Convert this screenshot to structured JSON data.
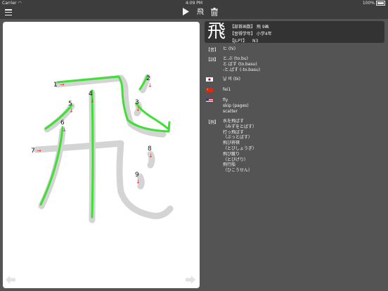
{
  "status": {
    "carrier": "Carrier",
    "time": "4:09 PM",
    "battery": "100%"
  },
  "toolbar": {
    "icons": [
      "menu-icon",
      "play-icon",
      "kanji-toggle-icon",
      "trash-icon"
    ],
    "kanji_label": "飛"
  },
  "canvas": {
    "strokes": [
      {
        "number": "1",
        "arrow": "→"
      },
      {
        "number": "2",
        "arrow": "↓"
      },
      {
        "number": "3",
        "arrow": "↓"
      },
      {
        "number": "4",
        "arrow": "↓"
      },
      {
        "number": "5",
        "arrow": "↓"
      },
      {
        "number": "6",
        "arrow": "↓"
      },
      {
        "number": "7",
        "arrow": "→"
      },
      {
        "number": "8",
        "arrow": "↓"
      },
      {
        "number": "9",
        "arrow": "↓"
      }
    ],
    "nav": {
      "prev": "prev-arrow-icon",
      "next": "next-arrow-icon"
    }
  },
  "kanji": {
    "character": "飛",
    "line1": "【部首画数】 飛 9画",
    "line2": "【習得学年】 小学4年",
    "line3_label": "【JLPT】",
    "line3_value": "N3"
  },
  "sections": {
    "on": {
      "label": "【音】",
      "lines": [
        "ヒ (hi)"
      ]
    },
    "kun": {
      "label": "【訓】",
      "lines": [
        "と.ぶ (to.bu)",
        "と.ばす (to.basu)",
        "-と.ばす (-to.basu)"
      ]
    },
    "korean": {
      "label": "【KR】",
      "lines": [
        "날 비 (bi)"
      ]
    },
    "chinese": {
      "label": "【CN】",
      "lines": [
        "fei1"
      ]
    },
    "english": {
      "label": "【US】",
      "lines": [
        "fly",
        "skip (pages)",
        "scatter"
      ]
    },
    "examples": {
      "label": "【例】",
      "lines": [
        "水を飛ばす",
        "（みずをとばす）",
        "打っ飛ばす",
        "（ぶっとばす）",
        "飛び将棋",
        "（とびしょうぎ）",
        "飛び蹴り",
        "（とびげり）",
        "飛行船",
        "（ひこうせん）"
      ]
    }
  }
}
